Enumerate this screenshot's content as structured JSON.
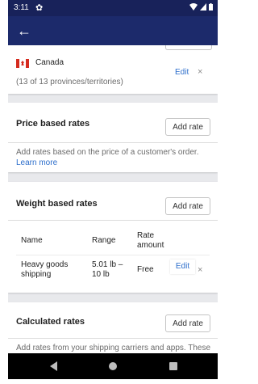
{
  "status_bar": {
    "time": "3:11",
    "gear_icon": "gear-icon",
    "wifi_icon": "wifi-icon",
    "signal_icon": "signal-icon",
    "battery_icon": "battery-icon"
  },
  "app_bar": {
    "back_icon": "arrow-back-icon"
  },
  "region": {
    "country": "Canada",
    "provinces": "(13 of 13 provinces/territories)",
    "edit_label": "Edit",
    "remove_label": "×"
  },
  "price_rates": {
    "title": "Price based rates",
    "add_label": "Add rate",
    "desc": "Add rates based on the price of a customer's order.",
    "learn_more": "Learn more"
  },
  "weight_rates": {
    "title": "Weight based rates",
    "add_label": "Add rate",
    "columns": {
      "name": "Name",
      "range": "Range",
      "rate_line1": "Rate",
      "rate_line2": "amount"
    },
    "rows": [
      {
        "name_line1": "Heavy goods",
        "name_line2": "shipping",
        "range_line1": "5.01 lb –",
        "range_line2": "10 lb",
        "rate": "Free",
        "edit_label": "Edit",
        "remove_label": "×"
      }
    ]
  },
  "calculated_rates": {
    "title": "Calculated rates",
    "add_label": "Add rate",
    "desc": "Add rates from your shipping carriers and apps. These"
  },
  "colors": {
    "app_bar": "#1c2a6b",
    "status_bar": "#18225a",
    "link": "#2c6ecb",
    "background": "#e8e9ec"
  }
}
